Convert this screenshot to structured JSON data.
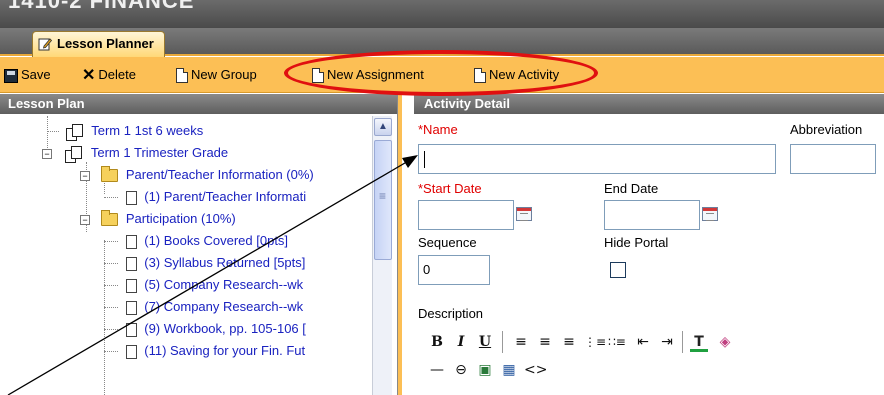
{
  "app": {
    "title": "1410-2 FINANCE"
  },
  "tabs": [
    {
      "label": "Lesson Planner",
      "icon": "pencil-note-icon"
    }
  ],
  "toolbar": {
    "save": "Save",
    "delete": "Delete",
    "new_group": "New Group",
    "new_assignment": "New Assignment",
    "new_activity": "New Activity"
  },
  "lesson_plan": {
    "title": "Lesson Plan",
    "items": [
      {
        "label": "Term 1 1st 6 weeks"
      },
      {
        "label": "Term 1 Trimester Grade"
      },
      {
        "label": "Parent/Teacher Information (0%)"
      },
      {
        "label": "(1) Parent/Teacher Informati"
      },
      {
        "label": "Participation (10%)"
      },
      {
        "label": "(1) Books Covered [0pts]"
      },
      {
        "label": "(3) Syllabus Returned [5pts]"
      },
      {
        "label": "(5) Company Research--wk"
      },
      {
        "label": "(7) Company Research--wk"
      },
      {
        "label": "(9) Workbook, pp. 105-106 ["
      },
      {
        "label": "(11) Saving for your Fin. Fut"
      }
    ]
  },
  "activity_detail": {
    "title": "Activity Detail",
    "name_label": "*Name",
    "name_value": "",
    "abbreviation_label": "Abbreviation",
    "start_date_label": "*Start Date",
    "end_date_label": "End Date",
    "sequence_label": "Sequence",
    "sequence_value": "0",
    "hide_portal_label": "Hide Portal",
    "description_label": "Description",
    "editor": {
      "bold": "B",
      "italic": "I",
      "underline": "U",
      "align_left": "≡",
      "align_center": "≡",
      "align_right": "≡",
      "numbered_list": "⋮≡",
      "bulleted_list": "∷≡",
      "outdent": "⇤",
      "indent": "⇥",
      "text_color": "T",
      "highlight": "◈",
      "hr": "—",
      "link": "⊖",
      "image": "▣",
      "table": "▦",
      "source": "<>"
    }
  },
  "colors": {
    "toolbar_bg": "#fcbf55",
    "header_gray": "#6b6b6b",
    "tree_link": "#1a22c0",
    "required": "#e00000",
    "annotation_red": "#e01010"
  }
}
